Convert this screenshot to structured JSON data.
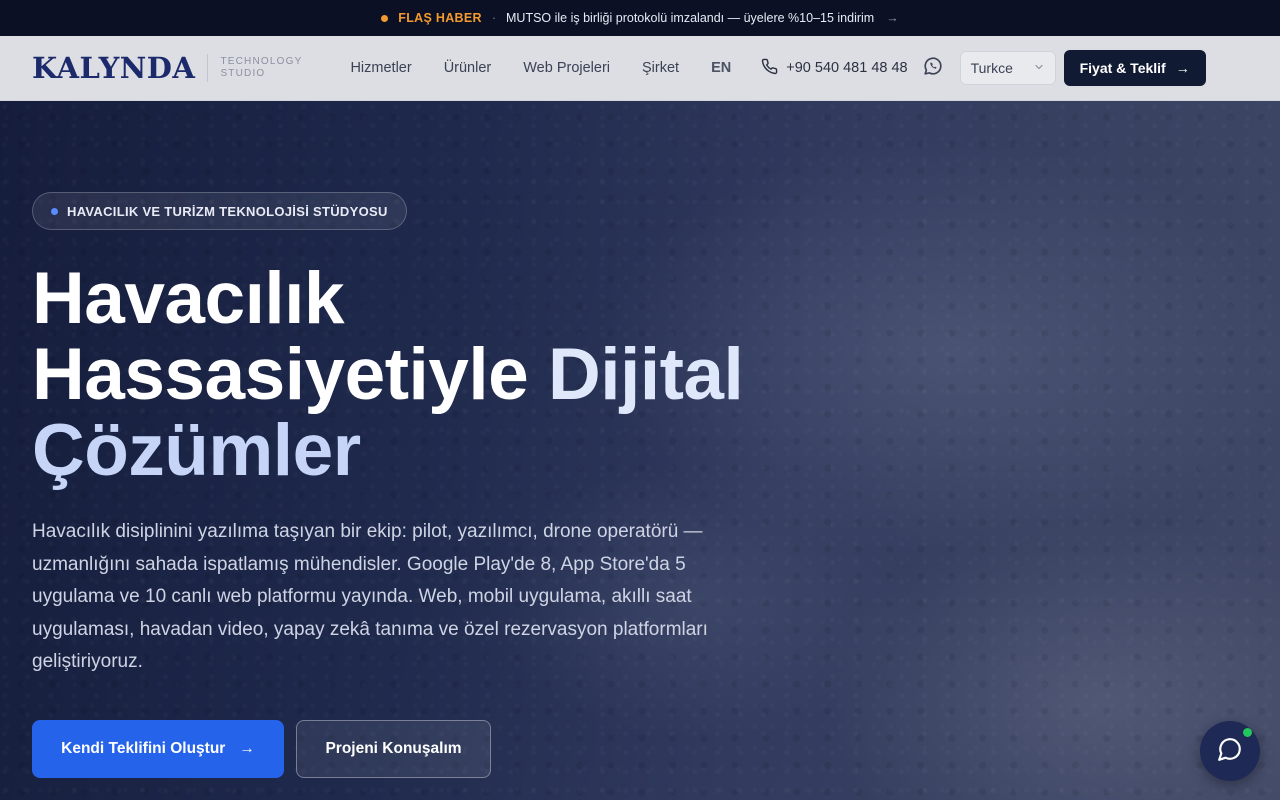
{
  "ticker": {
    "flash_label": "FLAŞ HABER",
    "separator": "·",
    "message": "MUTSO ile iş birliği protokolü imzalandı — üyelere %10–15 indirim",
    "arrow": "→"
  },
  "header": {
    "logo": "KALYNDA",
    "logo_sub_1": "TECHNOLOGY",
    "logo_sub_2": "STUDIO",
    "nav": [
      "Hizmetler",
      "Ürünler",
      "Web Projeleri",
      "Şirket"
    ],
    "lang_switch": "EN",
    "phone": "+90 540 481 48 48",
    "language_select": "Turkce",
    "cta_label": "Fiyat & Teklif",
    "cta_arrow": "→"
  },
  "hero": {
    "badge": "HAVACILIK VE TURİZM TEKNOLOJİSİ STÜDYOSU",
    "title_line1": "Havacılık",
    "title_line2_a": "Hassasiyetiyle ",
    "title_line2_b": "Dijital",
    "title_line3": "Çözümler",
    "lead": "Havacılık disiplinini yazılıma taşıyan bir ekip: pilot, yazılımcı, drone operatörü — uzmanlığını sahada ispatlamış mühendisler. Google Play'de 8, App Store'da 5 uygulama ve 10 canlı web platformu yayında. Web, mobil uygulama, akıllı saat uygulaması, havadan video, yapay zekâ tanıma ve özel rezervasyon platformları geliştiriyoruz.",
    "primary_btn": "Kendi Teklifini Oluştur",
    "primary_arrow": "→",
    "secondary_btn": "Projeni Konuşalım"
  },
  "colors": {
    "brand": "#1c2a6b",
    "accent": "#2563eb",
    "flash": "#f29a2e",
    "online": "#22c55e"
  },
  "icons": [
    "phone-icon",
    "whatsapp-icon",
    "chevron-down-icon",
    "arrow-right-icon",
    "chat-icon"
  ]
}
